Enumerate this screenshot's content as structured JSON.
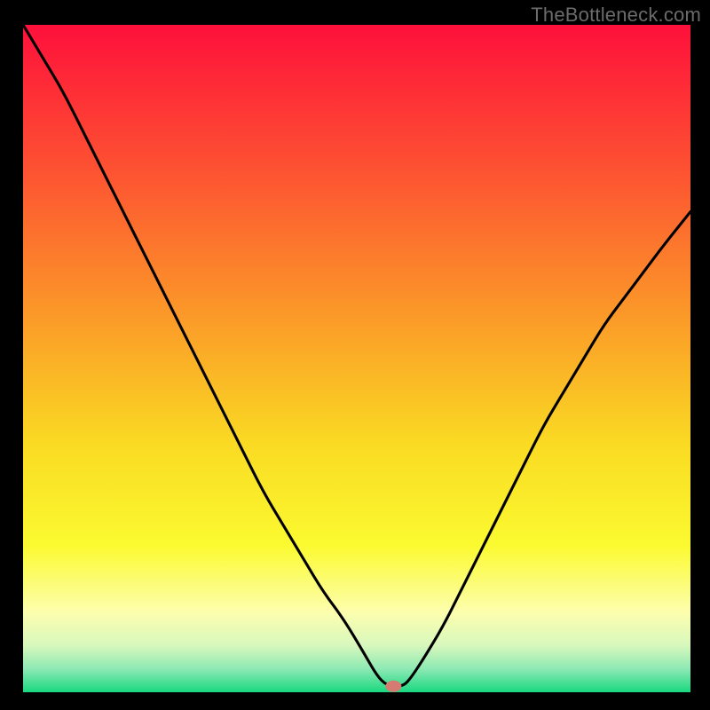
{
  "watermark": "TheBottleneck.com",
  "chart_data": {
    "type": "line",
    "title": "",
    "xlabel": "",
    "ylabel": "",
    "xlim": [
      0,
      100
    ],
    "ylim": [
      0,
      100
    ],
    "series": [
      {
        "name": "curve",
        "x": [
          0,
          3,
          6,
          9,
          12,
          15,
          18,
          21,
          24,
          27,
          30,
          33,
          36,
          39,
          42,
          45,
          48,
          51,
          53,
          54.5,
          56,
          57,
          58,
          60,
          63,
          66,
          69,
          72,
          75,
          78,
          81,
          84,
          87,
          90,
          93,
          96,
          100
        ],
        "y": [
          100,
          95,
          90,
          84,
          78,
          72,
          66,
          60,
          54,
          48,
          42,
          36,
          30,
          25,
          20,
          15,
          11,
          6,
          2.5,
          1,
          1,
          1,
          2,
          5,
          10,
          16,
          22,
          28,
          34,
          40,
          45,
          50,
          55,
          59,
          63,
          67,
          72
        ]
      }
    ],
    "marker": {
      "x": 55.5,
      "y": 0.9,
      "color": "#d67b71"
    },
    "background_gradient": {
      "type": "vertical",
      "stops": [
        {
          "pos": 0.0,
          "color": "#fe103b"
        },
        {
          "pos": 0.23,
          "color": "#fd5631"
        },
        {
          "pos": 0.45,
          "color": "#fb9e28"
        },
        {
          "pos": 0.63,
          "color": "#fadb23"
        },
        {
          "pos": 0.78,
          "color": "#fbfa30"
        },
        {
          "pos": 0.88,
          "color": "#fdfeae"
        },
        {
          "pos": 0.93,
          "color": "#d7f8bd"
        },
        {
          "pos": 0.965,
          "color": "#8de9b3"
        },
        {
          "pos": 1.0,
          "color": "#19d880"
        }
      ]
    }
  }
}
